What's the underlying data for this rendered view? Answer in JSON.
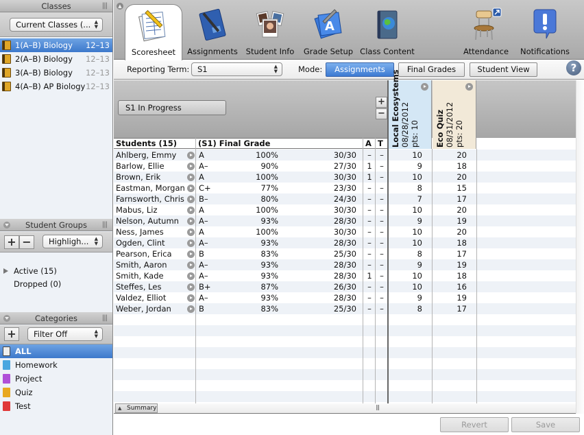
{
  "sidebar": {
    "classes": {
      "title": "Classes",
      "filter": "Current Classes (...",
      "items": [
        {
          "name": "1(A–B) Biology",
          "year": "12–13",
          "selected": true
        },
        {
          "name": "2(A–B) Biology",
          "year": "12–13",
          "selected": false
        },
        {
          "name": "3(A–B) Biology",
          "year": "12–13",
          "selected": false
        },
        {
          "name": "4(A–B) AP Biology",
          "year": "12–13",
          "selected": false
        }
      ]
    },
    "student_groups": {
      "title": "Student Groups",
      "add": "+",
      "remove": "−",
      "highlight": "Highligh...",
      "items": [
        "Active (15)",
        "Dropped (0)"
      ]
    },
    "categories": {
      "title": "Categories",
      "add": "+",
      "filter": "Filter Off",
      "items": [
        {
          "name": "ALL",
          "color": "#c8c8c8",
          "selected": true
        },
        {
          "name": "Homework",
          "color": "#4aa6e0",
          "selected": false
        },
        {
          "name": "Project",
          "color": "#b050d8",
          "selected": false
        },
        {
          "name": "Quiz",
          "color": "#e8a820",
          "selected": false
        },
        {
          "name": "Test",
          "color": "#e03838",
          "selected": false
        }
      ]
    }
  },
  "toolbar": {
    "tabs": [
      "Scoresheet",
      "Assignments",
      "Student Info",
      "Grade Setup",
      "Class Content"
    ],
    "right_tabs": [
      "Attendance",
      "Notifications"
    ],
    "active": "Scoresheet"
  },
  "modebar": {
    "term_label": "Reporting Term:",
    "term_value": "S1",
    "mode_label": "Mode:",
    "modes": [
      "Assignments",
      "Final Grades",
      "Student View"
    ],
    "active_mode": "Assignments",
    "help": "?"
  },
  "grid": {
    "term_button": "S1 In Progress",
    "plus": "+",
    "minus": "−",
    "headers": {
      "students": "Students (15)",
      "final": "(S1) Final Grade",
      "a": "A",
      "t": "T"
    },
    "assignments": [
      {
        "name": "Local Ecosystems",
        "date": "08/28/2012",
        "pts": "pts: 10",
        "color": "#d4e7f5"
      },
      {
        "name": "Eco Quiz",
        "date": "08/31/2012",
        "pts": "pts: 20",
        "color": "#f2e9d8"
      }
    ],
    "students": [
      {
        "name": "Ahlberg, Emmy",
        "grade": "A",
        "pct": "100%",
        "pts": "30/30",
        "a": "–",
        "t": "–",
        "scores": [
          "10",
          "20"
        ]
      },
      {
        "name": "Barlow, Ellie",
        "grade": "A–",
        "pct": "90%",
        "pts": "27/30",
        "a": "1",
        "t": "–",
        "scores": [
          "9",
          "18"
        ]
      },
      {
        "name": "Brown, Erik",
        "grade": "A",
        "pct": "100%",
        "pts": "30/30",
        "a": "1",
        "t": "–",
        "scores": [
          "10",
          "20"
        ]
      },
      {
        "name": "Eastman, Morgan",
        "grade": "C+",
        "pct": "77%",
        "pts": "23/30",
        "a": "–",
        "t": "–",
        "scores": [
          "8",
          "15"
        ]
      },
      {
        "name": "Farnsworth, Chris",
        "grade": "B–",
        "pct": "80%",
        "pts": "24/30",
        "a": "–",
        "t": "–",
        "scores": [
          "7",
          "17"
        ]
      },
      {
        "name": "Mabus, Liz",
        "grade": "A",
        "pct": "100%",
        "pts": "30/30",
        "a": "–",
        "t": "–",
        "scores": [
          "10",
          "20"
        ]
      },
      {
        "name": "Nelson, Autumn",
        "grade": "A–",
        "pct": "93%",
        "pts": "28/30",
        "a": "–",
        "t": "–",
        "scores": [
          "9",
          "19"
        ]
      },
      {
        "name": "Ness, James",
        "grade": "A",
        "pct": "100%",
        "pts": "30/30",
        "a": "–",
        "t": "–",
        "scores": [
          "10",
          "20"
        ]
      },
      {
        "name": "Ogden, Clint",
        "grade": "A–",
        "pct": "93%",
        "pts": "28/30",
        "a": "–",
        "t": "–",
        "scores": [
          "10",
          "18"
        ]
      },
      {
        "name": "Pearson, Erica",
        "grade": "B",
        "pct": "83%",
        "pts": "25/30",
        "a": "–",
        "t": "–",
        "scores": [
          "8",
          "17"
        ]
      },
      {
        "name": "Smith, Aaron",
        "grade": "A–",
        "pct": "93%",
        "pts": "28/30",
        "a": "–",
        "t": "–",
        "scores": [
          "9",
          "19"
        ]
      },
      {
        "name": "Smith, Kade",
        "grade": "A–",
        "pct": "93%",
        "pts": "28/30",
        "a": "1",
        "t": "–",
        "scores": [
          "10",
          "18"
        ]
      },
      {
        "name": "Steffes, Les",
        "grade": "B+",
        "pct": "87%",
        "pts": "26/30",
        "a": "–",
        "t": "–",
        "scores": [
          "10",
          "16"
        ]
      },
      {
        "name": "Valdez, Elliot",
        "grade": "A–",
        "pct": "93%",
        "pts": "28/30",
        "a": "–",
        "t": "–",
        "scores": [
          "9",
          "19"
        ]
      },
      {
        "name": "Weber, Jordan",
        "grade": "B",
        "pct": "83%",
        "pts": "25/30",
        "a": "–",
        "t": "–",
        "scores": [
          "8",
          "17"
        ]
      }
    ],
    "summary": "Summary"
  },
  "footer": {
    "revert": "Revert",
    "save": "Save"
  }
}
